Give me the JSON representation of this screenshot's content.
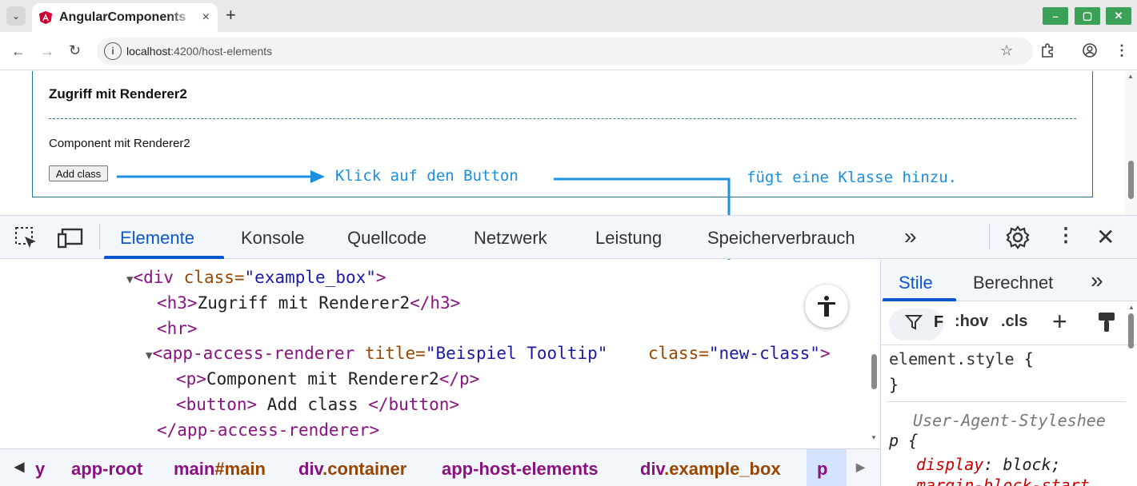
{
  "browser": {
    "tab_title": "AngularComponents",
    "tab_close": "×",
    "new_tab": "+",
    "window_min": "–",
    "window_max": "▢",
    "window_close": "✕",
    "url_host": "localhost",
    "url_path": ":4200/host-elements"
  },
  "page": {
    "heading": "Zugriff mit Renderer2",
    "paragraph": "Component mit Renderer2",
    "button_label": "Add class"
  },
  "annotations": {
    "click_text": "Klick auf den Button",
    "result_text": "fügt eine Klasse hinzu.",
    "color": "#1a8fe0"
  },
  "devtools": {
    "tabs": [
      {
        "label": "Elemente",
        "active": true
      },
      {
        "label": "Konsole"
      },
      {
        "label": "Quellcode"
      },
      {
        "label": "Netzwerk"
      },
      {
        "label": "Leistung"
      },
      {
        "label": "Speicherverbrauch"
      }
    ],
    "more_tabs": "»",
    "code": {
      "l1_tag_open": "<div",
      "l1_attr": " class=",
      "l1_val": "\"example_box\"",
      "l1_close": ">",
      "l2_open": "<h3>",
      "l2_text": "Zugriff mit Renderer2",
      "l2_close": "</h3>",
      "l3": "<hr>",
      "l4_tag_open": "<app-access-renderer",
      "l4_attr1": " title=",
      "l4_val1": "\"Beispiel Tooltip\"",
      "l4_attr2": "class=",
      "l4_val2": "\"new-class\"",
      "l4_close": ">",
      "l5_open": "<p>",
      "l5_text": "Component mit Renderer2",
      "l5_close": "</p>",
      "l6_open": "<button>",
      "l6_text": " Add class ",
      "l6_close": "</button>",
      "l7": "</app-access-renderer>"
    },
    "breadcrumb": [
      {
        "tag": "y",
        "cls": ""
      },
      {
        "tag": "app-root",
        "cls": ""
      },
      {
        "tag": "main",
        "cls": "#main"
      },
      {
        "tag": "div",
        "cls": ".container"
      },
      {
        "tag": "app-host-elements",
        "cls": ""
      },
      {
        "tag": "div",
        "cls": ".example_box"
      },
      {
        "tag": "p",
        "cls": ""
      }
    ],
    "styles_pane": {
      "tabs": [
        {
          "label": "Stile",
          "active": true
        },
        {
          "label": "Berechnet"
        }
      ],
      "filter_letter": "F",
      "hov": ":hov",
      "cls": ".cls",
      "element_style": "element.style",
      "brace_open": "{",
      "brace_close": "}",
      "ua_label": "User-Agent-Styleshee",
      "selector": "p",
      "prop1_name": "display",
      "prop1_value": "block;",
      "prop2_name": "margin-block-start"
    }
  },
  "colors": {
    "devtools_active": "#0b57d0",
    "tag": "#881280",
    "attr": "#994500",
    "value": "#1a1aa6",
    "window_buttons": "#3aa157"
  }
}
